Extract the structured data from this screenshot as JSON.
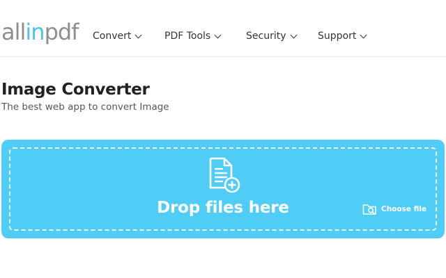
{
  "header": {
    "logo": {
      "part1": "all",
      "part2": "in",
      "part3": "pdf"
    },
    "nav": [
      {
        "label": "Convert"
      },
      {
        "label": "PDF Tools"
      },
      {
        "label": "Security"
      },
      {
        "label": "Support"
      }
    ]
  },
  "main": {
    "title": "Image Converter",
    "subtitle": "The best web app to convert Image"
  },
  "dropzone": {
    "drop_text": "Drop files here",
    "choose_file_label": "Choose file",
    "icons": {
      "upload": "file-add-icon",
      "choose": "folder-search-icon"
    }
  },
  "colors": {
    "accent": "#4fcdf6",
    "logo_gray": "#8e8e8e",
    "logo_accent": "#4cc3ec",
    "text": "#222222"
  }
}
